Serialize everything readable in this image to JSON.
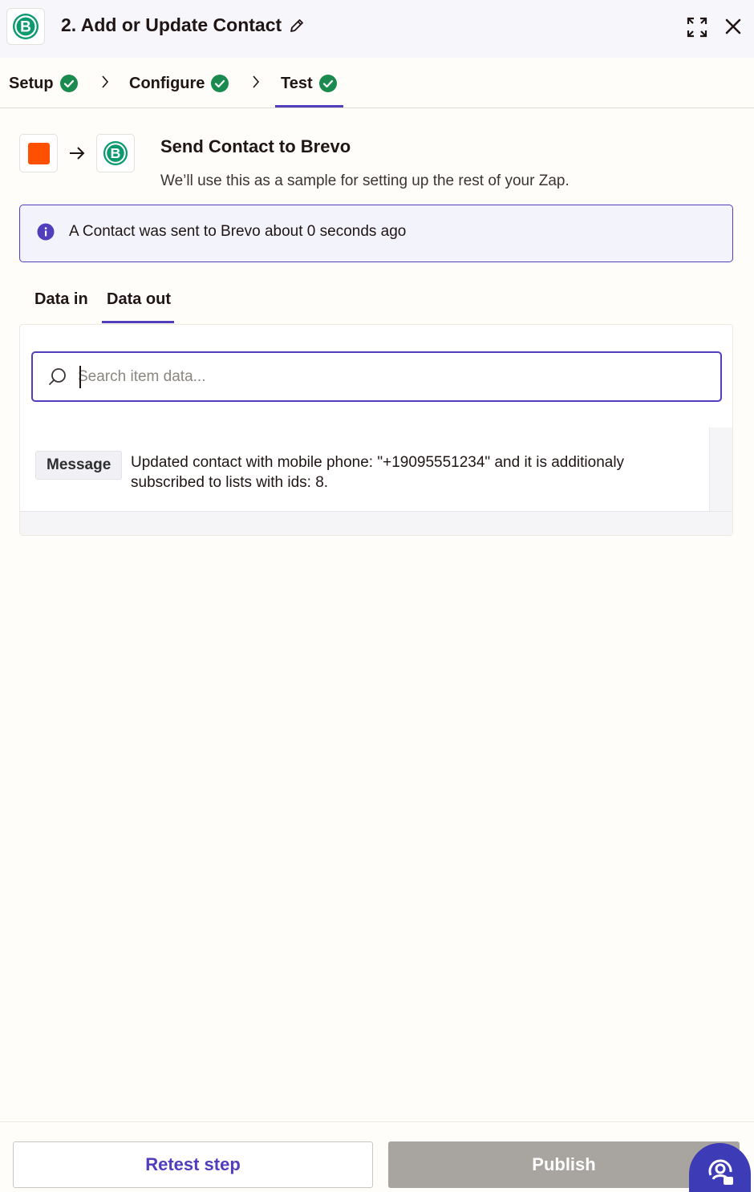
{
  "header": {
    "title": "2. Add or Update Contact",
    "app_icon": "brevo-logo",
    "icons": [
      "pencil-icon",
      "expand-icon",
      "close-icon"
    ]
  },
  "steps": [
    {
      "label": "Setup",
      "status": "complete"
    },
    {
      "label": "Configure",
      "status": "complete"
    },
    {
      "label": "Test",
      "status": "complete",
      "active": true
    }
  ],
  "send": {
    "title": "Send Contact to Brevo",
    "subtitle": "We’ll use this as a sample for setting up the rest of your Zap."
  },
  "info": {
    "text": "A Contact was sent to Brevo about 0 seconds ago"
  },
  "tabs": [
    {
      "label": "Data in",
      "active": false
    },
    {
      "label": "Data out",
      "active": true
    }
  ],
  "data_panel": {
    "search_placeholder": "Search item data...",
    "rows": [
      {
        "key": "Message",
        "value": "Updated contact with mobile phone: \"+19095551234\" and it is additionaly subscribed to lists with ids: 8."
      }
    ]
  },
  "footer": {
    "retest_label": "Retest step",
    "publish_label": "Publish"
  },
  "colors": {
    "accent": "#503ebd",
    "success": "#1a8a4f",
    "brevo_green": "#0b996e",
    "trigger_orange": "#ff4f00",
    "disabled_button": "#a8a5a0",
    "help_button": "#3d3bb5"
  }
}
